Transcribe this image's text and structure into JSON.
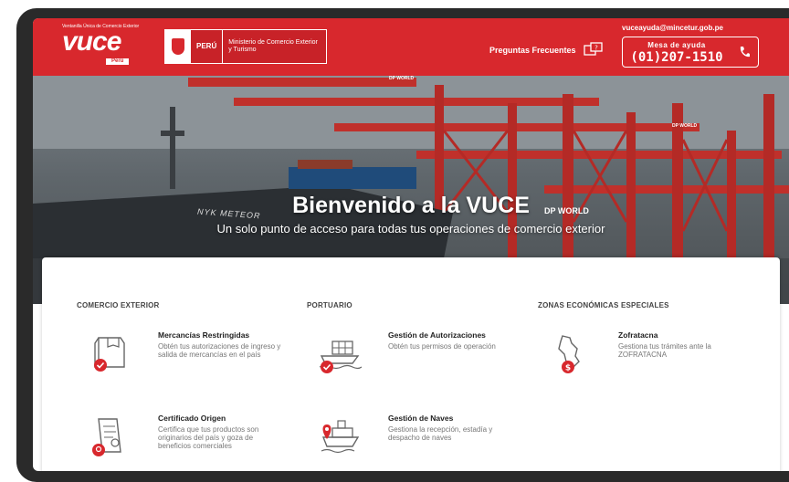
{
  "header": {
    "logo_tagline": "Ventanilla Única de Comercio Exterior",
    "logo_word": "vuce",
    "logo_sub": "Perú",
    "gov_country": "PERÚ",
    "gov_ministry": "Ministerio de Comercio Exterior y Turismo",
    "faq_label": "Preguntas Frecuentes",
    "email": "vuceayuda@mincetur.gob.pe",
    "help_label": "Mesa de ayuda",
    "help_phone": "(01)207-1510"
  },
  "hero": {
    "title": "Bienvenido a la VUCE",
    "subtitle": "Un solo punto de acceso para todas tus operaciones de comercio exterior",
    "ship_name": "NYK METEOR",
    "crane_brand_1": "DP WORLD",
    "crane_brand_2": "DP WORLD",
    "crane_brand_3": "DP WORLD"
  },
  "sections": [
    {
      "title": "COMERCIO EXTERIOR"
    },
    {
      "title": "PORTUARIO"
    },
    {
      "title": "ZONAS ECONÓMICAS ESPECIALES"
    }
  ],
  "items": {
    "mercancias": {
      "title": "Mercancías Restringidas",
      "desc": "Obtén tus autorizaciones de ingreso y salida de mercancías en el país",
      "icon": "package-check-icon"
    },
    "certificado": {
      "title": "Certificado Origen",
      "desc": "Certifica que tus productos son originarios del país y goza de beneficios comerciales",
      "icon": "certificate-icon"
    },
    "autorizaciones": {
      "title": "Gestión de Autorizaciones",
      "desc": "Obtén tus permisos de operación",
      "icon": "cargo-ship-check-icon"
    },
    "naves": {
      "title": "Gestión de Naves",
      "desc": "Gestiona la recepción, estadía y despacho de naves",
      "icon": "ship-location-icon"
    },
    "zofratacna": {
      "title": "Zofratacna",
      "desc": "Gestiona tus trámites ante la ZOFRATACNA",
      "icon": "peru-map-dollar-icon"
    }
  },
  "colors": {
    "brand_red": "#d8282d",
    "crane_red": "#c0302b"
  }
}
